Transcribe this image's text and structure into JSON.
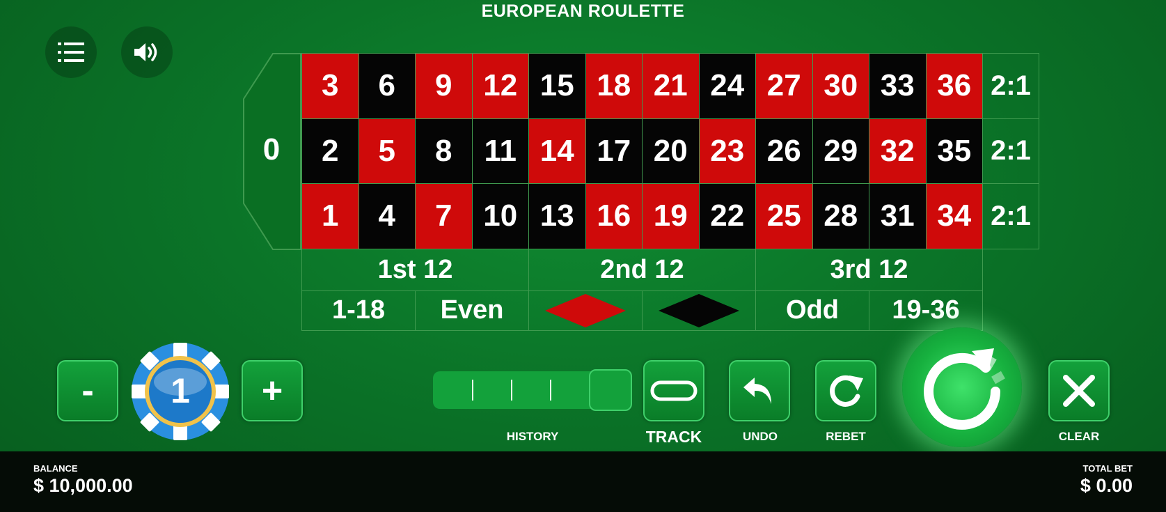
{
  "title": "EUROPEAN ROULETTE",
  "icons": {
    "menu": "menu-list-icon",
    "sound": "speaker-icon",
    "track": "track-racetrack-icon",
    "undo": "undo-arrow-icon",
    "rebet": "rebet-arrow-icon",
    "spin": "spin-icon",
    "clear": "close-x-icon"
  },
  "colors": {
    "red": "#cf0a0a",
    "black": "#050505",
    "felt": "#0b7428",
    "button": "#13a13b"
  },
  "board": {
    "zero": "0",
    "rows": [
      [
        {
          "n": "3",
          "c": "red"
        },
        {
          "n": "6",
          "c": "black"
        },
        {
          "n": "9",
          "c": "red"
        },
        {
          "n": "12",
          "c": "red"
        },
        {
          "n": "15",
          "c": "black"
        },
        {
          "n": "18",
          "c": "red"
        },
        {
          "n": "21",
          "c": "red"
        },
        {
          "n": "24",
          "c": "black"
        },
        {
          "n": "27",
          "c": "red"
        },
        {
          "n": "30",
          "c": "red"
        },
        {
          "n": "33",
          "c": "black"
        },
        {
          "n": "36",
          "c": "red"
        }
      ],
      [
        {
          "n": "2",
          "c": "black"
        },
        {
          "n": "5",
          "c": "red"
        },
        {
          "n": "8",
          "c": "black"
        },
        {
          "n": "11",
          "c": "black"
        },
        {
          "n": "14",
          "c": "red"
        },
        {
          "n": "17",
          "c": "black"
        },
        {
          "n": "20",
          "c": "black"
        },
        {
          "n": "23",
          "c": "red"
        },
        {
          "n": "26",
          "c": "black"
        },
        {
          "n": "29",
          "c": "black"
        },
        {
          "n": "32",
          "c": "red"
        },
        {
          "n": "35",
          "c": "black"
        }
      ],
      [
        {
          "n": "1",
          "c": "red"
        },
        {
          "n": "4",
          "c": "black"
        },
        {
          "n": "7",
          "c": "red"
        },
        {
          "n": "10",
          "c": "black"
        },
        {
          "n": "13",
          "c": "black"
        },
        {
          "n": "16",
          "c": "red"
        },
        {
          "n": "19",
          "c": "red"
        },
        {
          "n": "22",
          "c": "black"
        },
        {
          "n": "25",
          "c": "red"
        },
        {
          "n": "28",
          "c": "black"
        },
        {
          "n": "31",
          "c": "black"
        },
        {
          "n": "34",
          "c": "red"
        }
      ]
    ],
    "columns": [
      "2:1",
      "2:1",
      "2:1"
    ],
    "dozens": [
      "1st 12",
      "2nd 12",
      "3rd 12"
    ],
    "even_money": [
      "1-18",
      "Even",
      "",
      "",
      "Odd",
      "19-36"
    ]
  },
  "chip": {
    "minus": "-",
    "value": "1",
    "plus": "+"
  },
  "labels": {
    "history": "HISTORY",
    "track": "TRACK",
    "undo": "UNDO",
    "rebet": "REBET",
    "clear": "CLEAR"
  },
  "balance": {
    "label": "BALANCE",
    "value": "$ 10,000.00"
  },
  "total_bet": {
    "label": "TOTAL BET",
    "value": "$ 0.00"
  }
}
